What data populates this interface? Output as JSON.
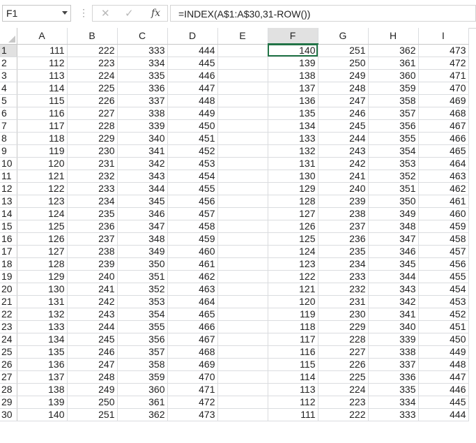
{
  "name_box": {
    "value": "F1"
  },
  "formula_bar": {
    "cancel_icon": "✕",
    "enter_icon": "✓",
    "fx_label": "fx",
    "formula": "=INDEX(A$1:A$30,31-ROW())"
  },
  "columns": [
    "A",
    "B",
    "C",
    "D",
    "E",
    "F",
    "G",
    "H",
    "I"
  ],
  "active_cell": {
    "col": "F",
    "row": 1
  },
  "rows": [
    {
      "n": "1",
      "A": "111",
      "B": "222",
      "C": "333",
      "D": "444",
      "E": "",
      "F": "140",
      "G": "251",
      "H": "362",
      "I": "473"
    },
    {
      "n": "2",
      "A": "112",
      "B": "223",
      "C": "334",
      "D": "445",
      "E": "",
      "F": "139",
      "G": "250",
      "H": "361",
      "I": "472"
    },
    {
      "n": "3",
      "A": "113",
      "B": "224",
      "C": "335",
      "D": "446",
      "E": "",
      "F": "138",
      "G": "249",
      "H": "360",
      "I": "471"
    },
    {
      "n": "4",
      "A": "114",
      "B": "225",
      "C": "336",
      "D": "447",
      "E": "",
      "F": "137",
      "G": "248",
      "H": "359",
      "I": "470"
    },
    {
      "n": "5",
      "A": "115",
      "B": "226",
      "C": "337",
      "D": "448",
      "E": "",
      "F": "136",
      "G": "247",
      "H": "358",
      "I": "469"
    },
    {
      "n": "6",
      "A": "116",
      "B": "227",
      "C": "338",
      "D": "449",
      "E": "",
      "F": "135",
      "G": "246",
      "H": "357",
      "I": "468"
    },
    {
      "n": "7",
      "A": "117",
      "B": "228",
      "C": "339",
      "D": "450",
      "E": "",
      "F": "134",
      "G": "245",
      "H": "356",
      "I": "467"
    },
    {
      "n": "8",
      "A": "118",
      "B": "229",
      "C": "340",
      "D": "451",
      "E": "",
      "F": "133",
      "G": "244",
      "H": "355",
      "I": "466"
    },
    {
      "n": "9",
      "A": "119",
      "B": "230",
      "C": "341",
      "D": "452",
      "E": "",
      "F": "132",
      "G": "243",
      "H": "354",
      "I": "465"
    },
    {
      "n": "10",
      "A": "120",
      "B": "231",
      "C": "342",
      "D": "453",
      "E": "",
      "F": "131",
      "G": "242",
      "H": "353",
      "I": "464"
    },
    {
      "n": "11",
      "A": "121",
      "B": "232",
      "C": "343",
      "D": "454",
      "E": "",
      "F": "130",
      "G": "241",
      "H": "352",
      "I": "463"
    },
    {
      "n": "12",
      "A": "122",
      "B": "233",
      "C": "344",
      "D": "455",
      "E": "",
      "F": "129",
      "G": "240",
      "H": "351",
      "I": "462"
    },
    {
      "n": "13",
      "A": "123",
      "B": "234",
      "C": "345",
      "D": "456",
      "E": "",
      "F": "128",
      "G": "239",
      "H": "350",
      "I": "461"
    },
    {
      "n": "14",
      "A": "124",
      "B": "235",
      "C": "346",
      "D": "457",
      "E": "",
      "F": "127",
      "G": "238",
      "H": "349",
      "I": "460"
    },
    {
      "n": "15",
      "A": "125",
      "B": "236",
      "C": "347",
      "D": "458",
      "E": "",
      "F": "126",
      "G": "237",
      "H": "348",
      "I": "459"
    },
    {
      "n": "16",
      "A": "126",
      "B": "237",
      "C": "348",
      "D": "459",
      "E": "",
      "F": "125",
      "G": "236",
      "H": "347",
      "I": "458"
    },
    {
      "n": "17",
      "A": "127",
      "B": "238",
      "C": "349",
      "D": "460",
      "E": "",
      "F": "124",
      "G": "235",
      "H": "346",
      "I": "457"
    },
    {
      "n": "18",
      "A": "128",
      "B": "239",
      "C": "350",
      "D": "461",
      "E": "",
      "F": "123",
      "G": "234",
      "H": "345",
      "I": "456"
    },
    {
      "n": "19",
      "A": "129",
      "B": "240",
      "C": "351",
      "D": "462",
      "E": "",
      "F": "122",
      "G": "233",
      "H": "344",
      "I": "455"
    },
    {
      "n": "20",
      "A": "130",
      "B": "241",
      "C": "352",
      "D": "463",
      "E": "",
      "F": "121",
      "G": "232",
      "H": "343",
      "I": "454"
    },
    {
      "n": "21",
      "A": "131",
      "B": "242",
      "C": "353",
      "D": "464",
      "E": "",
      "F": "120",
      "G": "231",
      "H": "342",
      "I": "453"
    },
    {
      "n": "22",
      "A": "132",
      "B": "243",
      "C": "354",
      "D": "465",
      "E": "",
      "F": "119",
      "G": "230",
      "H": "341",
      "I": "452"
    },
    {
      "n": "23",
      "A": "133",
      "B": "244",
      "C": "355",
      "D": "466",
      "E": "",
      "F": "118",
      "G": "229",
      "H": "340",
      "I": "451"
    },
    {
      "n": "24",
      "A": "134",
      "B": "245",
      "C": "356",
      "D": "467",
      "E": "",
      "F": "117",
      "G": "228",
      "H": "339",
      "I": "450"
    },
    {
      "n": "25",
      "A": "135",
      "B": "246",
      "C": "357",
      "D": "468",
      "E": "",
      "F": "116",
      "G": "227",
      "H": "338",
      "I": "449"
    },
    {
      "n": "26",
      "A": "136",
      "B": "247",
      "C": "358",
      "D": "469",
      "E": "",
      "F": "115",
      "G": "226",
      "H": "337",
      "I": "448"
    },
    {
      "n": "27",
      "A": "137",
      "B": "248",
      "C": "359",
      "D": "470",
      "E": "",
      "F": "114",
      "G": "225",
      "H": "336",
      "I": "447"
    },
    {
      "n": "28",
      "A": "138",
      "B": "249",
      "C": "360",
      "D": "471",
      "E": "",
      "F": "113",
      "G": "224",
      "H": "335",
      "I": "446"
    },
    {
      "n": "29",
      "A": "139",
      "B": "250",
      "C": "361",
      "D": "472",
      "E": "",
      "F": "112",
      "G": "223",
      "H": "334",
      "I": "445"
    },
    {
      "n": "30",
      "A": "140",
      "B": "251",
      "C": "362",
      "D": "473",
      "E": "",
      "F": "111",
      "G": "222",
      "H": "333",
      "I": "444"
    }
  ],
  "colors": {
    "accent": "#217346",
    "grid_line": "#dadcdf",
    "header_selected": "#e1e1e1"
  }
}
